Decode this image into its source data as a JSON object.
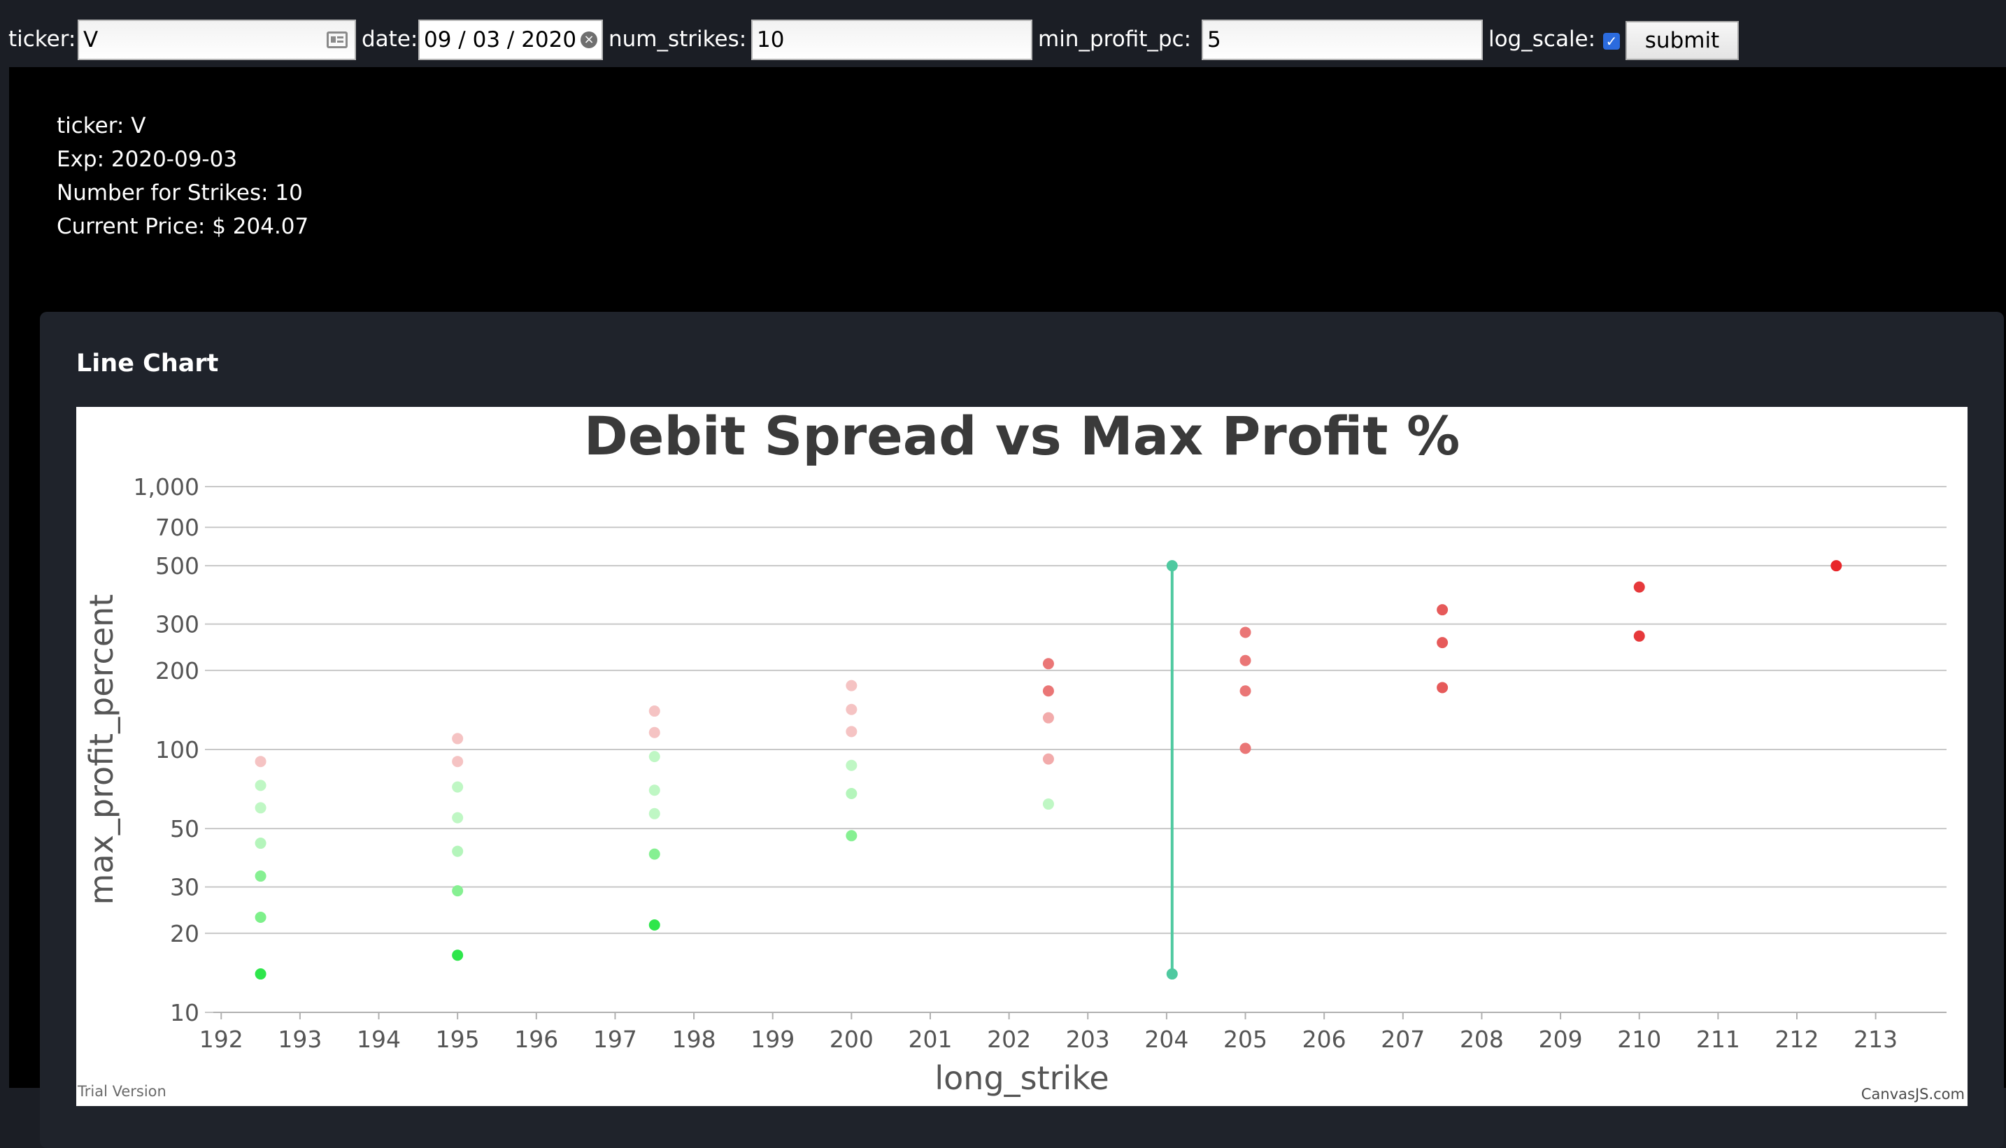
{
  "form": {
    "ticker_label": "ticker:",
    "ticker_value": "V",
    "date_label": "date:",
    "date_value": "09 / 03 / 2020",
    "num_strikes_label": "num_strikes:",
    "num_strikes_value": "10",
    "min_profit_label": "min_profit_pc:",
    "min_profit_value": "5",
    "log_scale_label": "log_scale:",
    "log_scale_checked": true,
    "submit_label": "submit"
  },
  "info": {
    "ticker": "ticker: V",
    "exp": "Exp: 2020-09-03",
    "strikes": "Number for Strikes: 10",
    "price": "Current Price: $ 204.07"
  },
  "card": {
    "title": "Line Chart",
    "trial": "Trial Version",
    "credit": "CanvasJS.com"
  },
  "colors": {
    "page_bg": "#1b1e25",
    "content_bg": "#000000",
    "card_bg": "#1f232b",
    "line": "#4fc9a0",
    "green_dark": "#2ee64b",
    "red_dark": "#e8262a"
  },
  "chart_data": {
    "type": "scatter",
    "title": "Debit Spread vs Max Profit %",
    "xlabel": "long_strike",
    "ylabel": "max_profit_percent",
    "y_scale": "log",
    "xlim": [
      191.9,
      213.9
    ],
    "ylim": [
      10,
      1000
    ],
    "x_ticks": [
      192,
      193,
      194,
      195,
      196,
      197,
      198,
      199,
      200,
      201,
      202,
      203,
      204,
      205,
      206,
      207,
      208,
      209,
      210,
      211,
      212,
      213
    ],
    "y_ticks": [
      10,
      20,
      30,
      50,
      100,
      200,
      300,
      500,
      700,
      1000
    ],
    "y_tick_labels": [
      "10",
      "20",
      "30",
      "50",
      "100",
      "200",
      "300",
      "500",
      "700",
      "1,000"
    ],
    "grid": true,
    "legend": "none",
    "current_price_line": {
      "x": 204.07,
      "y_from": 14,
      "y_to": 500
    },
    "points": [
      {
        "x": 192.5,
        "y": 14,
        "color": "#2ee64b"
      },
      {
        "x": 192.5,
        "y": 23,
        "color": "#7df08a"
      },
      {
        "x": 192.5,
        "y": 33,
        "color": "#86f092"
      },
      {
        "x": 192.5,
        "y": 44,
        "color": "#b4f5bb"
      },
      {
        "x": 192.5,
        "y": 60,
        "color": "#bff7c4"
      },
      {
        "x": 192.5,
        "y": 73,
        "color": "#bff7c4"
      },
      {
        "x": 192.5,
        "y": 90,
        "color": "#f5c3c3"
      },
      {
        "x": 195,
        "y": 16.5,
        "color": "#2ee64b"
      },
      {
        "x": 195,
        "y": 29,
        "color": "#86f092"
      },
      {
        "x": 195,
        "y": 41,
        "color": "#b4f5bb"
      },
      {
        "x": 195,
        "y": 55,
        "color": "#bff7c4"
      },
      {
        "x": 195,
        "y": 72,
        "color": "#bff7c4"
      },
      {
        "x": 195,
        "y": 90,
        "color": "#f5c3c3"
      },
      {
        "x": 195,
        "y": 110,
        "color": "#f5c3c3"
      },
      {
        "x": 197.5,
        "y": 21.5,
        "color": "#2ee64b"
      },
      {
        "x": 197.5,
        "y": 40,
        "color": "#86f092"
      },
      {
        "x": 197.5,
        "y": 57,
        "color": "#bff7c4"
      },
      {
        "x": 197.5,
        "y": 70,
        "color": "#bff7c4"
      },
      {
        "x": 197.5,
        "y": 94,
        "color": "#bff7c4"
      },
      {
        "x": 197.5,
        "y": 116,
        "color": "#f5c3c3"
      },
      {
        "x": 197.5,
        "y": 140,
        "color": "#f5c3c3"
      },
      {
        "x": 200,
        "y": 47,
        "color": "#86f092"
      },
      {
        "x": 200,
        "y": 68,
        "color": "#b4f5bb"
      },
      {
        "x": 200,
        "y": 87,
        "color": "#bff7c4"
      },
      {
        "x": 200,
        "y": 117,
        "color": "#f5c3c3"
      },
      {
        "x": 200,
        "y": 142,
        "color": "#f5c3c3"
      },
      {
        "x": 200,
        "y": 175,
        "color": "#f5c3c3"
      },
      {
        "x": 202.5,
        "y": 62,
        "color": "#bff7c4"
      },
      {
        "x": 202.5,
        "y": 92,
        "color": "#f2abab"
      },
      {
        "x": 202.5,
        "y": 132,
        "color": "#f2abab"
      },
      {
        "x": 202.5,
        "y": 167,
        "color": "#ea7676"
      },
      {
        "x": 202.5,
        "y": 212,
        "color": "#ea7676"
      },
      {
        "x": 205,
        "y": 101,
        "color": "#ea7676"
      },
      {
        "x": 205,
        "y": 167,
        "color": "#ea7676"
      },
      {
        "x": 205,
        "y": 218,
        "color": "#ea7676"
      },
      {
        "x": 205,
        "y": 279,
        "color": "#ea7676"
      },
      {
        "x": 207.5,
        "y": 172,
        "color": "#e65a5a"
      },
      {
        "x": 207.5,
        "y": 255,
        "color": "#e65a5a"
      },
      {
        "x": 207.5,
        "y": 340,
        "color": "#e65a5a"
      },
      {
        "x": 210,
        "y": 270,
        "color": "#e6393b"
      },
      {
        "x": 210,
        "y": 415,
        "color": "#e6393b"
      },
      {
        "x": 212.5,
        "y": 500,
        "color": "#e8262a"
      }
    ]
  }
}
